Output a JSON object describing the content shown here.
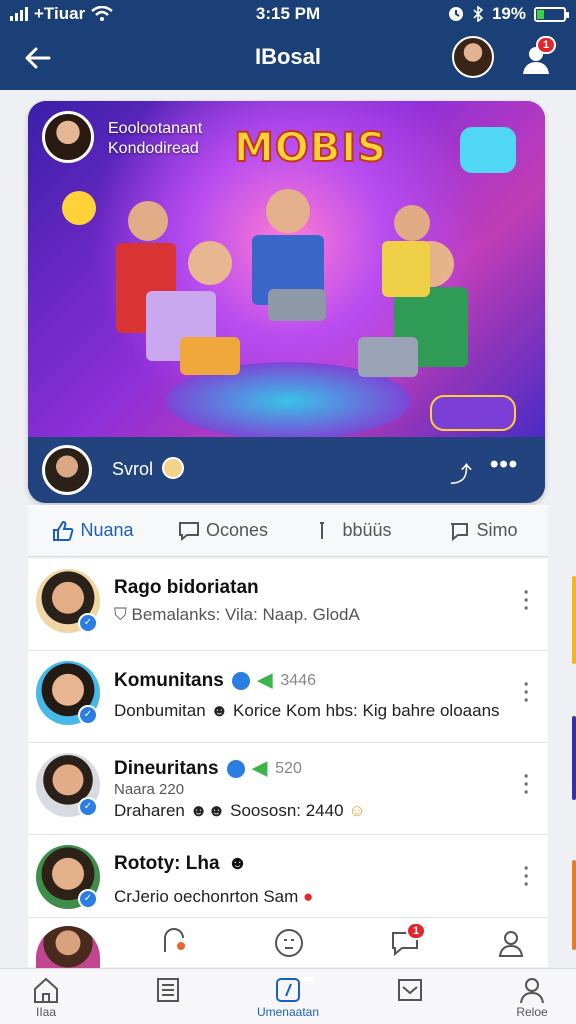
{
  "status": {
    "carrier": "+Tiuar",
    "time": "3:15 PM",
    "battery": "19%"
  },
  "header": {
    "title": "IBosal",
    "notif_count": "1",
    "back_icon": "arrow-left-icon"
  },
  "hero": {
    "caption_line1": "Eoolootanant",
    "caption_line2": "Kondodiread",
    "logo": "MOBIS",
    "author_name": "Svrol"
  },
  "actions": [
    {
      "label": "Nuana",
      "icon": "like-icon"
    },
    {
      "label": "Ocones",
      "icon": "comment-icon"
    },
    {
      "label": "bbüüs",
      "icon": "share-icon"
    },
    {
      "label": "Simo",
      "icon": "chat-icon"
    }
  ],
  "list": [
    {
      "title": "Rago bidoriatan",
      "meta": "Bemalanks: Vila: Naap. GlodA"
    },
    {
      "title": "Komunitans",
      "count": "3446",
      "meta": "Donbumitan",
      "meta2": "Korice Kom hbs: Kig bahre oloaans"
    },
    {
      "title": "Dineuritans",
      "count": "520",
      "meta_top": "Naara 220",
      "meta": "Draharen",
      "meta2": "Soososn: 2440"
    },
    {
      "title": "Rototy: Lha",
      "meta": "Cr",
      "meta2": "Jerio",
      "meta3": "oechonrton Sam"
    }
  ],
  "strip": {
    "notif_count": "1"
  },
  "tabs": [
    {
      "label": "IIaa"
    },
    {
      "label": ""
    },
    {
      "label": "Umenaatan",
      "badge": ""
    },
    {
      "label": ""
    },
    {
      "label": "Reloe"
    }
  ]
}
